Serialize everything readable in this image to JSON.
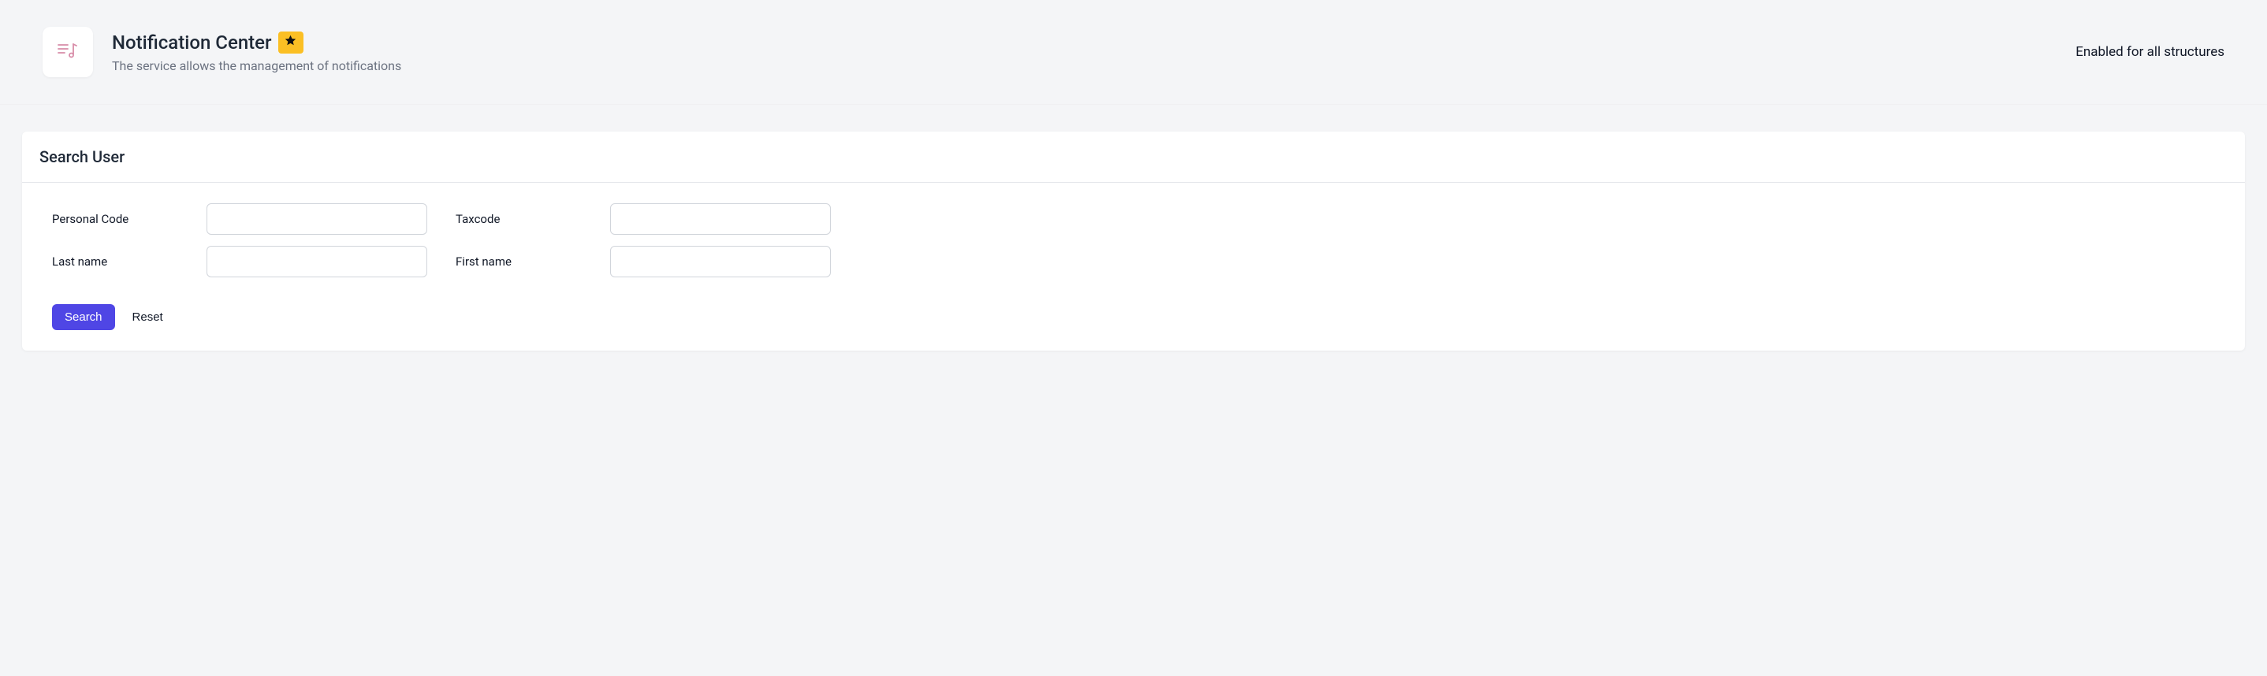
{
  "header": {
    "title": "Notification Center",
    "subtitle": "The service allows the management of notifications",
    "enabled_text": "Enabled for all structures"
  },
  "panel": {
    "title": "Search User"
  },
  "form": {
    "personal_code_label": "Personal Code",
    "taxcode_label": "Taxcode",
    "lastname_label": "Last name",
    "firstname_label": "First name",
    "personal_code_value": "",
    "taxcode_value": "",
    "lastname_value": "",
    "firstname_value": ""
  },
  "buttons": {
    "search": "Search",
    "reset": "Reset"
  },
  "colors": {
    "primary": "#4f46e5",
    "star_bg": "#fbbf24"
  }
}
